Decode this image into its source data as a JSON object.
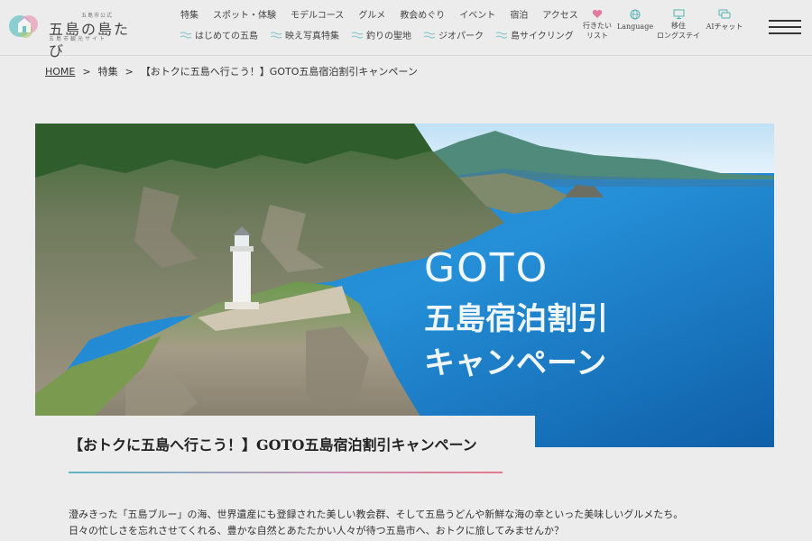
{
  "logo": {
    "small": "五島市公式",
    "main": "五島の島たび",
    "sub": "五島市観光サイト"
  },
  "nav": {
    "primary": [
      "特集",
      "スポット・体験",
      "モデルコース",
      "グルメ",
      "教会めぐり",
      "イベント",
      "宿泊",
      "アクセス"
    ],
    "secondary": [
      "はじめての五島",
      "映え写真特集",
      "釣りの聖地",
      "ジオパーク",
      "島サイクリング"
    ]
  },
  "utility": {
    "wishlist": [
      "行きたい",
      "リスト"
    ],
    "language": "Language",
    "longstay": [
      "移住",
      "ロングステイ"
    ],
    "ai_chat": "AIチャット"
  },
  "breadcrumb": {
    "home": "HOME",
    "sep": ">",
    "feature": "特集",
    "current": "【おトクに五島へ行こう！】GOTO五島宿泊割引キャンペーン"
  },
  "hero": {
    "line1": "GOTO",
    "line2": "五島宿泊割引",
    "line3": "キャンペーン"
  },
  "page_title": "【おトクに五島へ行こう！】GOTO五島宿泊割引キャンペーン",
  "intro": {
    "line1": "澄みきった「五島ブルー」の海、世界遺産にも登録された美しい教会群、そして五島うどんや新鮮な海の幸といった美味しいグルメたち。",
    "line2": "日々の忙しさを忘れさせてくれる、豊かな自然とあたたかい人々が待つ五島市へ、おトクに旅してみませんか？"
  },
  "colors": {
    "background": "#ececec",
    "accent_teal": "#5fb7c4",
    "accent_pink": "#e47b8d"
  }
}
